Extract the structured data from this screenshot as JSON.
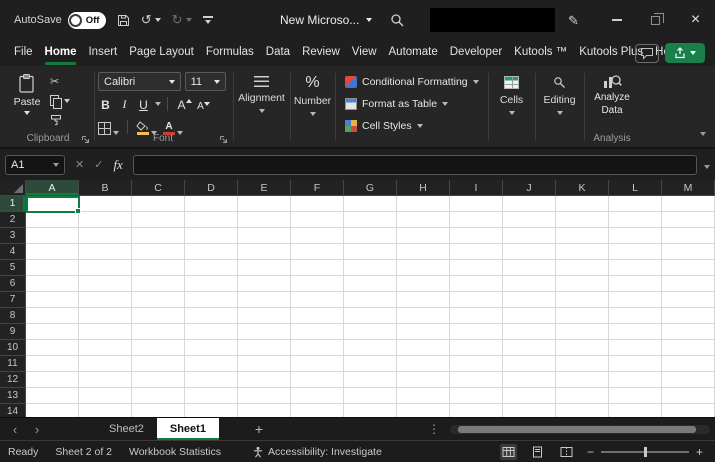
{
  "colors": {
    "accent_green": "#107C41",
    "share_button_green": "#1A7F4B",
    "font_color_red": "#C8402F",
    "fill_yellow": "#F2C04A",
    "grid_line": "#D8D8D8"
  },
  "titlebar": {
    "autosave_label": "AutoSave",
    "autosave_state": "Off",
    "title": "New Microso..."
  },
  "icons": {
    "undo": "↺",
    "redo": "↻",
    "cut": "✂",
    "pen": "✎",
    "close": "×",
    "cancel": "✕",
    "check": "✓"
  },
  "menu": {
    "tabs": [
      "File",
      "Home",
      "Insert",
      "Page Layout",
      "Formulas",
      "Data",
      "Review",
      "View",
      "Automate",
      "Developer",
      "Kutools ™",
      "Kutools Plus",
      "Help"
    ],
    "active_tab": "Home"
  },
  "ribbon": {
    "clipboard": {
      "paste_label": "Paste",
      "group_label": "Clipboard"
    },
    "font": {
      "font_name": "Calibri",
      "font_size": "11",
      "bold_label": "B",
      "italic_label": "I",
      "underline_label": "U",
      "letter_label": "A",
      "group_label": "Font"
    },
    "alignment": {
      "label": "Alignment"
    },
    "number": {
      "symbol": "%",
      "label": "Number"
    },
    "styles": {
      "buttons": [
        "Conditional Formatting",
        "Format as Table",
        "Cell Styles"
      ]
    },
    "cells": {
      "label": "Cells"
    },
    "editing": {
      "label": "Editing"
    },
    "analysis": {
      "button_line1": "Analyze",
      "button_line2": "Data",
      "group_label": "Analysis"
    }
  },
  "formula_bar": {
    "name_box_value": "A1",
    "fx_label": "fx",
    "formula_value": ""
  },
  "grid": {
    "columns": [
      "A",
      "B",
      "C",
      "D",
      "E",
      "F",
      "G",
      "H",
      "I",
      "J",
      "K",
      "L",
      "M"
    ],
    "rows": [
      "1",
      "2",
      "3",
      "4",
      "5",
      "6",
      "7",
      "8",
      "9",
      "10",
      "11",
      "12",
      "13",
      "14"
    ],
    "selected_cell": "A1",
    "selected_column": "A",
    "selected_row": "1"
  },
  "sheet_tabs": {
    "prev_icon": "‹",
    "next_icon": "›",
    "tabs": [
      {
        "label": "Sheet2",
        "active": false
      },
      {
        "label": "Sheet1",
        "active": true
      }
    ],
    "add_label": "+",
    "more_label": "⋮"
  },
  "status_bar": {
    "mode": "Ready",
    "sheet_info": "Sheet 2 of 2",
    "workbook_statistics": "Workbook Statistics",
    "accessibility_label": "Accessibility: Investigate",
    "zoom_minus": "−",
    "zoom_plus": "+"
  }
}
